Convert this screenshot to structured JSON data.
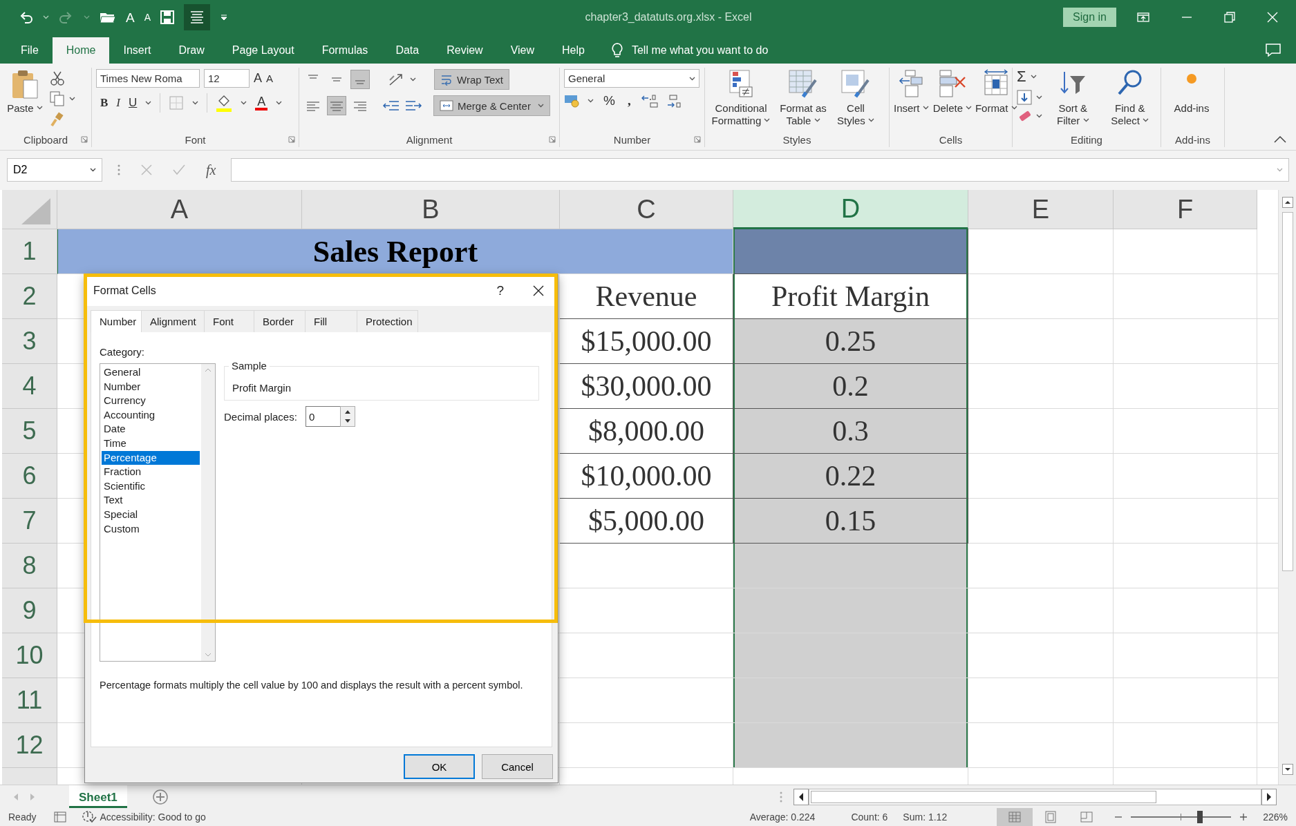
{
  "window": {
    "title": "chapter3_datatuts.org.xlsx  -  Excel",
    "sign_in": "Sign in"
  },
  "quick_access": {
    "grow_font": "A",
    "shrink_font": "A"
  },
  "menu_tabs": [
    {
      "label": "File",
      "selected": false
    },
    {
      "label": "Home",
      "selected": true
    },
    {
      "label": "Insert",
      "selected": false
    },
    {
      "label": "Draw",
      "selected": false
    },
    {
      "label": "Page Layout",
      "selected": false
    },
    {
      "label": "Formulas",
      "selected": false
    },
    {
      "label": "Data",
      "selected": false
    },
    {
      "label": "Review",
      "selected": false
    },
    {
      "label": "View",
      "selected": false
    },
    {
      "label": "Help",
      "selected": false
    }
  ],
  "tell_me": {
    "placeholder": "Tell me what you want to do"
  },
  "ribbon": {
    "clipboard": {
      "label": "Clipboard",
      "paste": "Paste"
    },
    "font": {
      "label": "Font",
      "font_name": "Times New Roma",
      "font_size": "12",
      "grow": "A",
      "shrink": "A",
      "bold": "B",
      "italic": "I",
      "underline": "U",
      "font_color": "A"
    },
    "alignment": {
      "label": "Alignment",
      "vertical": [
        {
          "on": false
        },
        {
          "on": false
        },
        {
          "on": true
        }
      ],
      "horizontal": [
        {
          "on": false
        },
        {
          "on": true
        },
        {
          "on": false
        }
      ],
      "wrap_text": {
        "label": "Wrap Text",
        "on": true
      },
      "merge": {
        "label": "Merge & Center",
        "on": true
      }
    },
    "number": {
      "label": "Number",
      "format": "General",
      "percent": "%",
      "comma": ","
    },
    "styles": {
      "label": "Styles",
      "buttons": [
        "Conditional Formatting",
        "Format as Table",
        "Cell Styles"
      ]
    },
    "cells": {
      "label": "Cells",
      "buttons": [
        "Insert",
        "Delete",
        "Format"
      ]
    },
    "editing": {
      "label": "Editing",
      "autosum": "Σ",
      "buttons": [
        "Sort & Filter",
        "Find & Select"
      ]
    },
    "add_ins": {
      "label": "Add-ins",
      "buttons": [
        "Add-ins"
      ]
    }
  },
  "formula_bar": {
    "name_box": "D2",
    "function": "fx"
  },
  "columns": [
    {
      "label": "A",
      "selected": false
    },
    {
      "label": "B",
      "selected": false
    },
    {
      "label": "C",
      "selected": false
    },
    {
      "label": "D",
      "selected": true
    },
    {
      "label": "E",
      "selected": false
    },
    {
      "label": "F",
      "selected": false
    }
  ],
  "rows": [
    {
      "header": "1",
      "title": "Sales Report",
      "column_d": {
        "selected": true
      }
    },
    {
      "header": "2",
      "column_c": {
        "text": "Revenue"
      },
      "column_d": {
        "text": "Profit Margin",
        "selected": true,
        "active": true
      }
    },
    {
      "header": "3",
      "column_c": {
        "text": "$15,000.00"
      },
      "column_d": {
        "text": "0.25",
        "selected": true
      }
    },
    {
      "header": "4",
      "column_c": {
        "text": "$30,000.00"
      },
      "column_d": {
        "text": "0.2",
        "selected": true
      }
    },
    {
      "header": "5",
      "column_c": {
        "text": "$8,000.00"
      },
      "column_d": {
        "text": "0.3",
        "selected": true
      }
    },
    {
      "header": "6",
      "column_c": {
        "text": "$10,000.00"
      },
      "column_d": {
        "text": "0.22",
        "selected": true
      }
    },
    {
      "header": "7",
      "column_c": {
        "text": "$5,000.00"
      },
      "column_d": {
        "text": "0.15",
        "selected": true
      }
    },
    {
      "header": "8",
      "column_d": {
        "selected": true
      }
    },
    {
      "header": "9",
      "column_d": {
        "selected": true
      }
    },
    {
      "header": "10",
      "column_d": {
        "selected": true
      }
    },
    {
      "header": "11",
      "column_d": {
        "selected": true
      }
    },
    {
      "header": "12",
      "column_d": {
        "selected": true
      }
    }
  ],
  "dialog": {
    "title": "Format Cells",
    "help": "?",
    "tabs": [
      {
        "label": "Number",
        "selected": true
      },
      {
        "label": "Alignment",
        "selected": false
      },
      {
        "label": "Font",
        "selected": false
      },
      {
        "label": "Border",
        "selected": false
      },
      {
        "label": "Fill",
        "selected": false
      },
      {
        "label": "Protection",
        "selected": false
      }
    ],
    "category_label": "Category:",
    "categories": [
      {
        "label": "General",
        "selected": false
      },
      {
        "label": "Number",
        "selected": false
      },
      {
        "label": "Currency",
        "selected": false
      },
      {
        "label": "Accounting",
        "selected": false
      },
      {
        "label": "Date",
        "selected": false
      },
      {
        "label": "Time",
        "selected": false
      },
      {
        "label": "Percentage",
        "selected": true
      },
      {
        "label": "Fraction",
        "selected": false
      },
      {
        "label": "Scientific",
        "selected": false
      },
      {
        "label": "Text",
        "selected": false
      },
      {
        "label": "Special",
        "selected": false
      },
      {
        "label": "Custom",
        "selected": false
      }
    ],
    "sample_label": "Sample",
    "sample_value": "Profit Margin",
    "decimal_label": "Decimal places:",
    "decimal_value": "0",
    "description": "Percentage formats multiply the cell value by 100 and displays the result with a percent symbol.",
    "buttons": [
      {
        "label": "OK",
        "kind": "default"
      },
      {
        "label": "Cancel",
        "kind": "normal"
      }
    ]
  },
  "sheet_tabs": [
    {
      "label": "Sheet1",
      "selected": true
    }
  ],
  "status_bar": {
    "mode": "Ready",
    "accessibility": "Accessibility: Good to go",
    "average": "Average: 0.224",
    "count": "Count: 6",
    "sum": "Sum: 1.12",
    "views": [
      {
        "selected": true
      },
      {
        "selected": false
      },
      {
        "selected": false
      }
    ],
    "zoom_slider": {
      "level": 0.69
    },
    "zoom": "226%"
  }
}
